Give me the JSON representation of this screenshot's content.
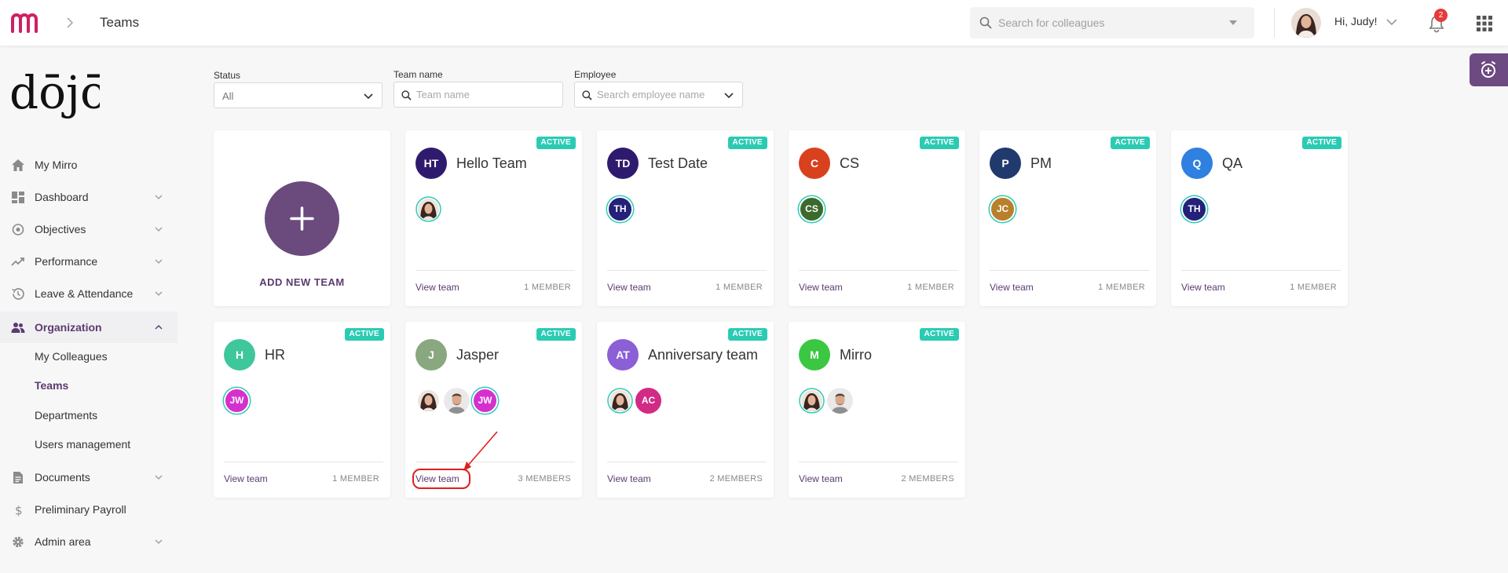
{
  "header": {
    "page_title": "Teams",
    "search_placeholder": "Search for colleagues",
    "greeting": "Hi, Judy!",
    "notification_count": "2"
  },
  "brand": {
    "logo_text": "dōjō"
  },
  "sidebar": {
    "items": [
      {
        "label": "My Mirro",
        "icon": "home-icon"
      },
      {
        "label": "Dashboard",
        "icon": "dashboard-icon"
      },
      {
        "label": "Objectives",
        "icon": "target-icon"
      },
      {
        "label": "Performance",
        "icon": "trend-icon"
      },
      {
        "label": "Leave & Attendance",
        "icon": "history-icon"
      },
      {
        "label": "Organization",
        "icon": "people-icon"
      },
      {
        "label": "Documents",
        "icon": "document-icon"
      },
      {
        "label": "Preliminary Payroll",
        "icon": "dollar-icon"
      },
      {
        "label": "Admin area",
        "icon": "gear-icon"
      }
    ],
    "sub_items": [
      "My Colleagues",
      "Teams",
      "Departments",
      "Users management"
    ]
  },
  "filters": {
    "status_label": "Status",
    "status_value": "All",
    "team_name_label": "Team name",
    "team_name_placeholder": "Team name",
    "employee_label": "Employee",
    "employee_placeholder": "Search employee name"
  },
  "add_card": {
    "label": "ADD NEW TEAM"
  },
  "card_common": {
    "status": "ACTIVE",
    "view_label": "View team"
  },
  "teams": [
    {
      "initials": "HT",
      "name": "Hello Team",
      "color": "#2f1b6e",
      "members_text": "1 MEMBER",
      "members": [
        {
          "type": "photo-f"
        }
      ]
    },
    {
      "initials": "TD",
      "name": "Test Date",
      "color": "#2f1b6e",
      "members_text": "1 MEMBER",
      "members": [
        {
          "type": "init",
          "text": "TH",
          "color": "#24217a"
        }
      ]
    },
    {
      "initials": "C",
      "name": "CS",
      "color": "#d9411e",
      "members_text": "1 MEMBER",
      "members": [
        {
          "type": "init",
          "text": "CS",
          "color": "#3c6a2c"
        }
      ]
    },
    {
      "initials": "P",
      "name": "PM",
      "color": "#203a6e",
      "members_text": "1 MEMBER",
      "members": [
        {
          "type": "init",
          "text": "JC",
          "color": "#b8802a"
        }
      ]
    },
    {
      "initials": "Q",
      "name": "QA",
      "color": "#2f80e0",
      "members_text": "1 MEMBER",
      "members": [
        {
          "type": "init",
          "text": "TH",
          "color": "#24217a"
        }
      ]
    },
    {
      "initials": "H",
      "name": "HR",
      "color": "#3ec79a",
      "members_text": "1 MEMBER",
      "members": [
        {
          "type": "init",
          "text": "JW",
          "color": "#d62fd0"
        }
      ]
    },
    {
      "initials": "J",
      "name": "Jasper",
      "color": "#8aa87f",
      "members_text": "3 MEMBERS",
      "members": [
        {
          "type": "photo-f-plain"
        },
        {
          "type": "photo-m"
        },
        {
          "type": "init",
          "text": "JW",
          "color": "#d62fd0"
        }
      ]
    },
    {
      "initials": "AT",
      "name": "Anniversary team",
      "color": "#8b5fd6",
      "members_text": "2 MEMBERS",
      "members": [
        {
          "type": "photo-f"
        },
        {
          "type": "init-plain",
          "text": "AC",
          "color": "#d12b85"
        }
      ]
    },
    {
      "initials": "M",
      "name": "Mirro",
      "color": "#3bc742",
      "members_text": "2 MEMBERS",
      "members": [
        {
          "type": "photo-f"
        },
        {
          "type": "photo-m"
        }
      ]
    }
  ]
}
